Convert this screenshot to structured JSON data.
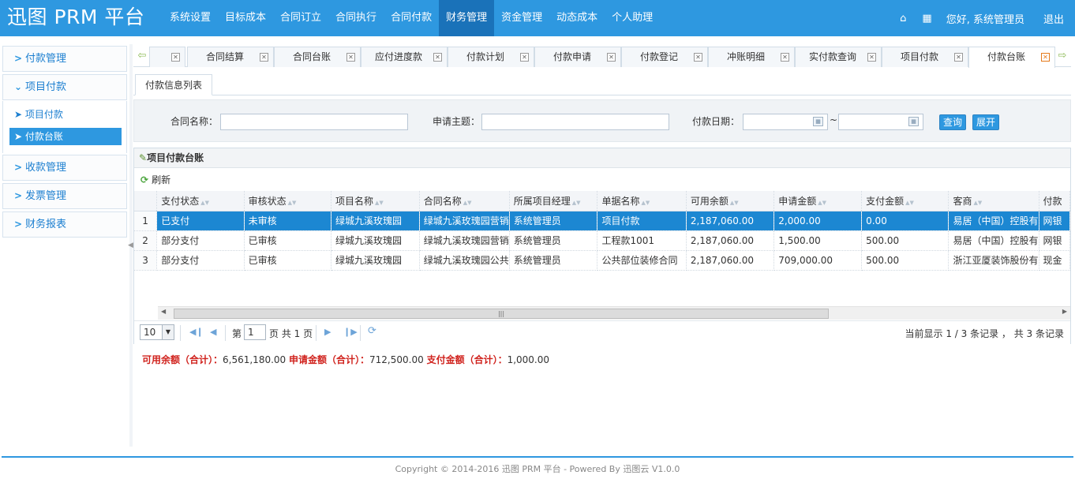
{
  "header": {
    "logo": "迅图 PRM 平台",
    "nav": [
      "系统设置",
      "目标成本",
      "合同订立",
      "合同执行",
      "合同付款",
      "财务管理",
      "资金管理",
      "动态成本",
      "个人助理"
    ],
    "active_nav": "财务管理",
    "home_icon": "home-icon",
    "grid_icon": "grid-icon",
    "greeting": "您好, 系统管理员",
    "logout": "退出"
  },
  "sidebar": {
    "groups": [
      "付款管理",
      "项目付款",
      "收款管理",
      "发票管理",
      "财务报表"
    ],
    "sub_items": [
      "项目付款",
      "付款台账"
    ],
    "active_sub": "付款台账"
  },
  "tabs": {
    "items": [
      "合同结算",
      "合同台账",
      "应付进度款",
      "付款计划",
      "付款申请",
      "付款登记",
      "冲账明细",
      "实付款查询",
      "项目付款",
      "付款台账"
    ],
    "active": "付款台账"
  },
  "subtab": "付款信息列表",
  "search": {
    "contract_label": "合同名称：",
    "subject_label": "申请主题：",
    "date_label": "付款日期：",
    "date_sep": "~",
    "query_btn": "查询",
    "expand_btn": "展开"
  },
  "panel": {
    "title": "项目付款台账",
    "refresh": "刷新"
  },
  "grid": {
    "columns": [
      "支付状态",
      "审核状态",
      "项目名称",
      "合同名称",
      "所属项目经理",
      "单据名称",
      "可用余额",
      "申请金额",
      "支付金额",
      "客商",
      "付款"
    ],
    "rows": [
      [
        "1",
        "已支付",
        "未审核",
        "绿城九溪玫瑰园",
        "绿城九溪玫瑰园营销",
        "系统管理员",
        "项目付款",
        "2,187,060.00",
        "2,000.00",
        "0.00",
        "易居（中国）控股有",
        "网银"
      ],
      [
        "2",
        "部分支付",
        "已审核",
        "绿城九溪玫瑰园",
        "绿城九溪玫瑰园营销",
        "系统管理员",
        "工程款1001",
        "2,187,060.00",
        "1,500.00",
        "500.00",
        "易居（中国）控股有",
        "网银"
      ],
      [
        "3",
        "部分支付",
        "已审核",
        "绿城九溪玫瑰园",
        "绿城九溪玫瑰园公共",
        "系统管理员",
        "公共部位装修合同",
        "2,187,060.00",
        "709,000.00",
        "500.00",
        "浙江亚厦装饰股份有",
        "现金"
      ]
    ],
    "selected_row": 0
  },
  "pager": {
    "page_size": "10",
    "page_prefix": "第",
    "page_value": "1",
    "page_suffix": "页 共 1 页",
    "info": "当前显示 1 / 3 条记录 ， 共 3 条记录"
  },
  "summary": {
    "avail_label": "可用余额（合计）：",
    "avail_value": "6,561,180.00",
    "apply_label": "申请金额（合计）：",
    "apply_value": "712,500.00",
    "paid_label": "支付金额（合计）：",
    "paid_value": "1,000.00"
  },
  "footer": "Copyright © 2014-2016 迅图 PRM 平台 - Powered By 迅图云 V1.0.0",
  "colors": {
    "brand": "#2e98e0",
    "active_nav": "#1a72b9",
    "selected_row": "#1c87d2",
    "summary_label": "#d0221d"
  }
}
